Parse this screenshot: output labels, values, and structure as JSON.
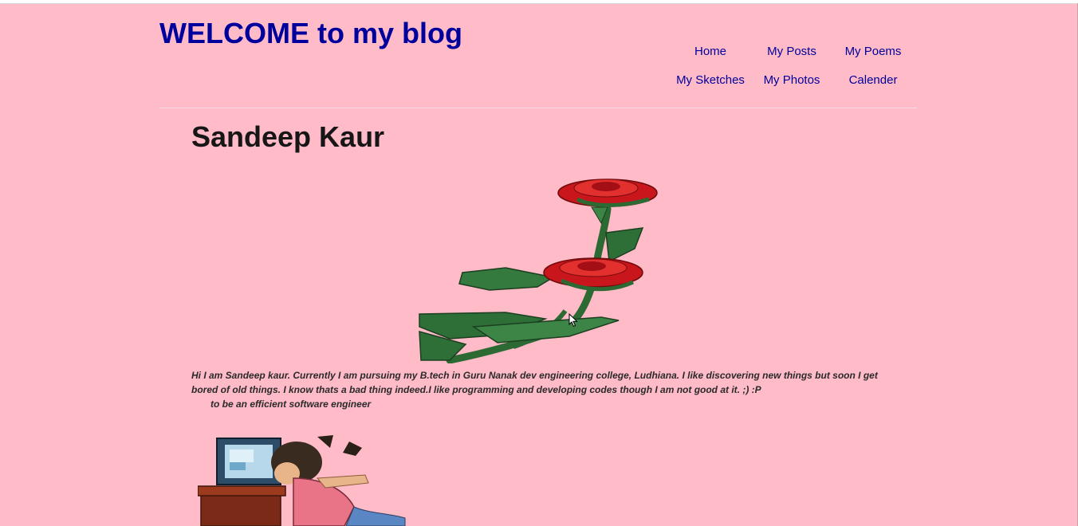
{
  "header": {
    "title": "WELCOME to my blog"
  },
  "nav": {
    "items": [
      {
        "label": "Home"
      },
      {
        "label": "My Posts"
      },
      {
        "label": "My Poems"
      },
      {
        "label": "My Sketches"
      },
      {
        "label": "My Photos"
      },
      {
        "label": "Calender"
      }
    ]
  },
  "main": {
    "author_name": "Sandeep Kaur",
    "bio_line": "Hi I am Sandeep kaur. Currently I am pursuing my B.tech in Guru Nanak dev engineering college, Ludhiana. I like discovering new things but soon I get bored of old things. I know thats a bad thing indeed.I like programming and developing codes though I am not good at it. ;) :P",
    "bio_goal": "to be an efficient software engineer",
    "images": {
      "top": "rose-image",
      "bottom": "computer-user-image"
    }
  },
  "colors": {
    "background": "#ffbbc8",
    "title": "#00009c",
    "link": "#00009c",
    "text": "#161616"
  }
}
